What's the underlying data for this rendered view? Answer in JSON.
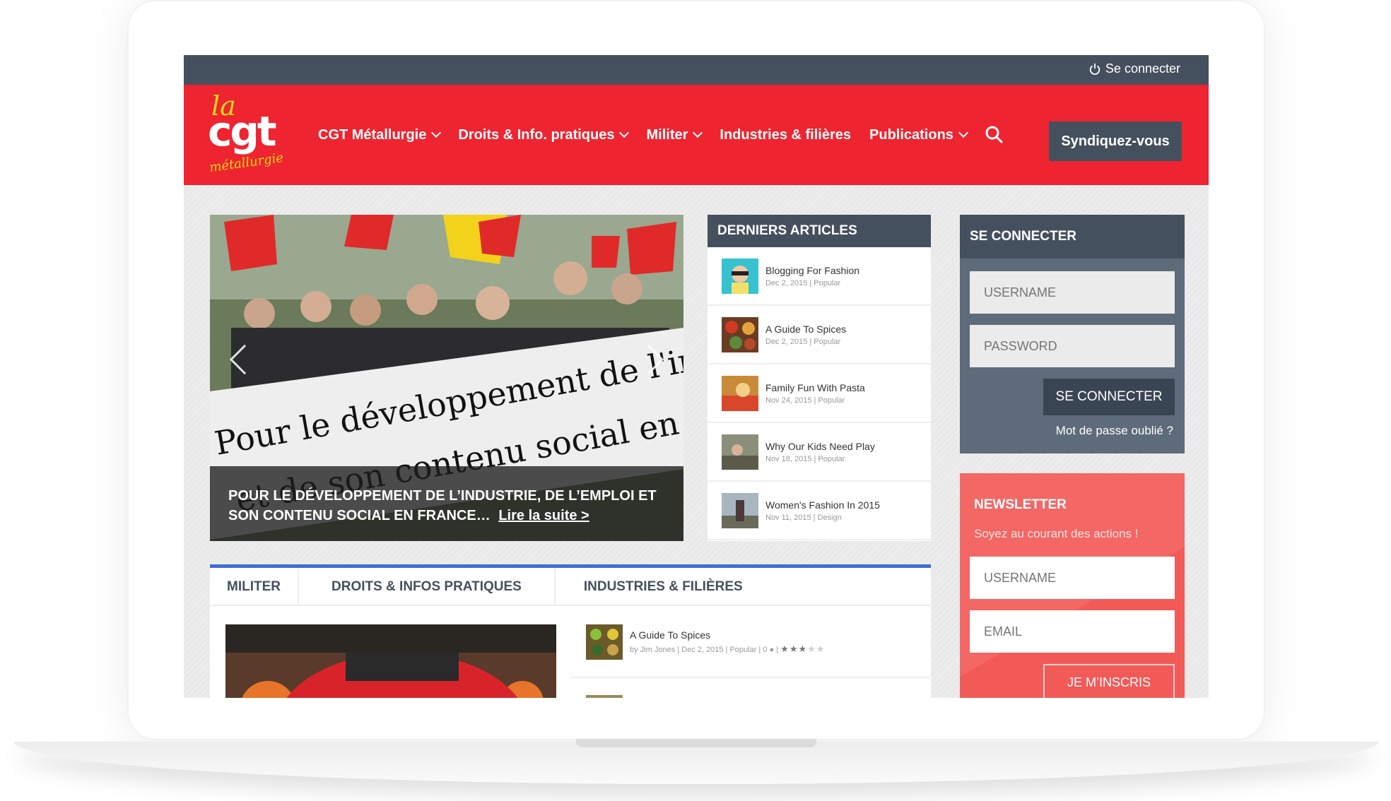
{
  "topbar": {
    "login_label": "Se connecter"
  },
  "logo": {
    "la": "la",
    "cgt": "cgt",
    "sub": "métallurgie"
  },
  "nav": {
    "items": [
      {
        "label": "CGT Métallurgie",
        "dropdown": true
      },
      {
        "label": "Droits & Info. pratiques",
        "dropdown": true
      },
      {
        "label": "Militer",
        "dropdown": true
      },
      {
        "label": "Industries & filières",
        "dropdown": false
      },
      {
        "label": "Publications",
        "dropdown": true
      }
    ],
    "cta": "Syndiquez-vous"
  },
  "slider": {
    "banner_line1": "Pour le développement de l'indust",
    "banner_line2": "et de son contenu social en Fran",
    "caption": "Pour le développement de l’industrie, de l’emploi et son contenu social en France…",
    "read_more": "Lire la suite >"
  },
  "latest": {
    "title": "DERNIERS ARTICLES",
    "articles": [
      {
        "title": "Blogging For Fashion",
        "meta": "Dec 2, 2015 | Popular"
      },
      {
        "title": "A Guide To Spices",
        "meta": "Dec 2, 2015 | Popular"
      },
      {
        "title": "Family Fun With Pasta",
        "meta": "Nov 24, 2015 | Popular"
      },
      {
        "title": "Why Our Kids Need Play",
        "meta": "Nov 18, 2015 | Popular"
      },
      {
        "title": "Women's Fashion In 2015",
        "meta": "Nov 11, 2015 | Design"
      }
    ]
  },
  "login": {
    "title": "SE CONNECTER",
    "username_placeholder": "USERNAME",
    "password_placeholder": "PASSWORD",
    "button": "SE CONNECTER",
    "forgot": "Mot de passe oublié ?"
  },
  "newsletter": {
    "title": "NEWSLETTER",
    "subtitle": "Soyez au courant des actions !",
    "username_placeholder": "USERNAME",
    "email_placeholder": "EMAIL",
    "button": "JE M’INSCRIS"
  },
  "tabs": {
    "items": [
      "MILITER",
      "DROITS & INFOS PRATIQUES",
      "INDUSTRIES & FILIÈRES"
    ],
    "posts": [
      {
        "title": "A Guide To Spices",
        "meta": "by Jim Jones | Dec 2, 2015 | Popular | 0",
        "rating": 3
      }
    ]
  },
  "colors": {
    "brand_red": "#ee2430",
    "slate": "#45505e",
    "newsletter": "#f25a58",
    "tab_accent": "#3e6fd6"
  }
}
